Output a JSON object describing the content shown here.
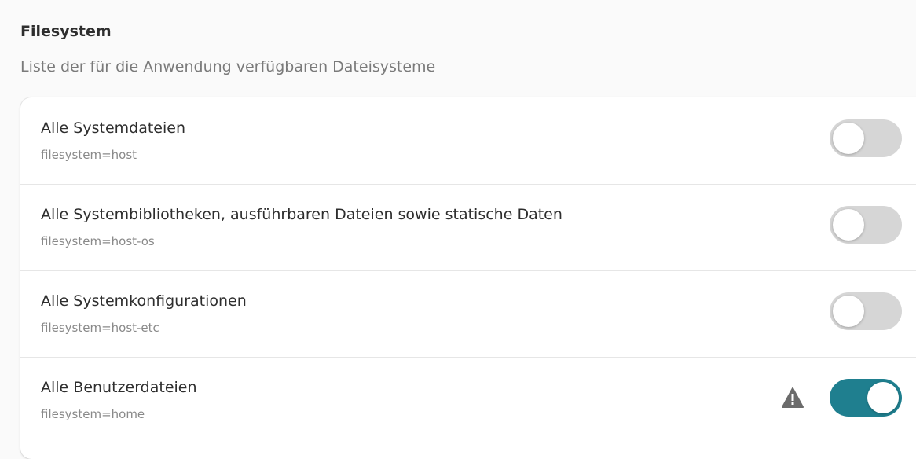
{
  "section": {
    "title": "Filesystem",
    "subtitle": "Liste der für die Anwendung verfügbaren Dateisysteme"
  },
  "rows": [
    {
      "title": "Alle Systemdateien",
      "subtitle": "filesystem=host",
      "enabled": false,
      "warning": false
    },
    {
      "title": "Alle Systembibliotheken, ausführbaren Dateien sowie statische Daten",
      "subtitle": "filesystem=host-os",
      "enabled": false,
      "warning": false
    },
    {
      "title": "Alle Systemkonfigurationen",
      "subtitle": "filesystem=host-etc",
      "enabled": false,
      "warning": false
    },
    {
      "title": "Alle Benutzerdateien",
      "subtitle": "filesystem=home",
      "enabled": true,
      "warning": true,
      "warning_icon": "warning-icon"
    }
  ],
  "colors": {
    "accent": "#1f7f8f",
    "switch_off": "#d6d6d6",
    "warning_icon": "#6b6b6b"
  }
}
